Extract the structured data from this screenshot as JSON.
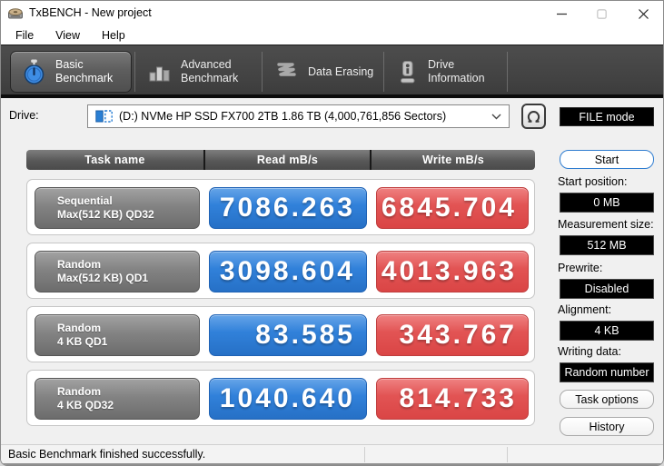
{
  "window": {
    "title": "TxBENCH - New project",
    "icons": {
      "app": "app-disk-icon",
      "minimize": "minimize-icon",
      "maximize": "maximize-icon",
      "close": "close-icon"
    }
  },
  "menu": {
    "items": [
      {
        "label": "File"
      },
      {
        "label": "View"
      },
      {
        "label": "Help"
      }
    ]
  },
  "tabs": [
    {
      "id": "basic-benchmark",
      "line1": "Basic",
      "line2": "Benchmark",
      "icon": "stopwatch-icon",
      "active": true
    },
    {
      "id": "advanced-benchmark",
      "line1": "Advanced",
      "line2": "Benchmark",
      "icon": "bar-chart-icon",
      "active": false
    },
    {
      "id": "data-erasing",
      "line1": "Data Erasing",
      "line2": "",
      "icon": "eraser-squiggle-icon",
      "active": false
    },
    {
      "id": "drive-information",
      "line1": "Drive",
      "line2": "Information",
      "icon": "drive-info-icon",
      "active": false
    }
  ],
  "drive_row": {
    "label": "Drive:",
    "selected": "(D:) NVMe HP SSD FX700 2TB  1.86 TB (4,000,761,856 Sectors)",
    "refresh_icon": "refresh-icon",
    "drive_icon": "drive-partition-icon",
    "file_mode_button": "FILE mode"
  },
  "benchmark_table": {
    "headers": [
      "Task name",
      "Read mB/s",
      "Write mB/s"
    ],
    "rows": [
      {
        "task_line1": "Sequential",
        "task_line2": "Max(512 KB) QD32",
        "read": "7086.263",
        "write": "6845.704"
      },
      {
        "task_line1": "Random",
        "task_line2": "Max(512 KB) QD1",
        "read": "3098.604",
        "write": "4013.963"
      },
      {
        "task_line1": "Random",
        "task_line2": "4 KB QD1",
        "read": "83.585",
        "write": "343.767"
      },
      {
        "task_line1": "Random",
        "task_line2": "4 KB QD32",
        "read": "1040.640",
        "write": "814.733"
      }
    ]
  },
  "sidebar": {
    "start_button": "Start",
    "fields": [
      {
        "label": "Start position:",
        "value": "0 MB"
      },
      {
        "label": "Measurement size:",
        "value": "512 MB"
      },
      {
        "label": "Prewrite:",
        "value": "Disabled"
      },
      {
        "label": "Alignment:",
        "value": "4 KB"
      },
      {
        "label": "Writing data:",
        "value": "Random number"
      }
    ],
    "task_options_button": "Task options",
    "history_button": "History"
  },
  "statusbar": {
    "text": "Basic Benchmark finished successfully."
  },
  "colors": {
    "read_blue": "#3181da",
    "write_red": "#e25454",
    "task_gray": "#838383",
    "tabbar_dark": "#424242",
    "field_black": "#000000",
    "accent_border_blue": "#2e7cd0"
  }
}
